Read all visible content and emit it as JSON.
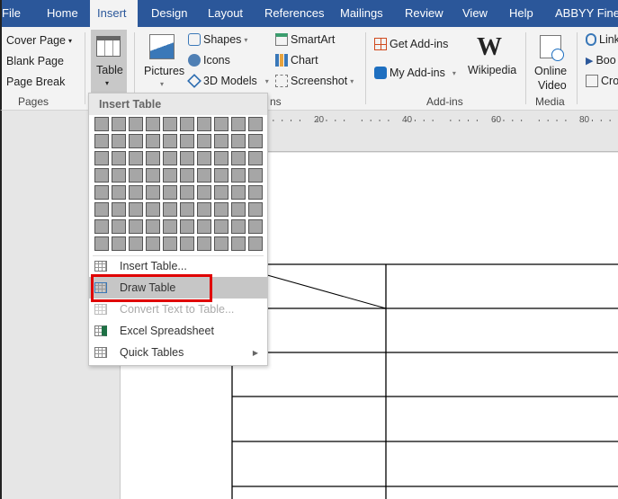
{
  "tabs": [
    {
      "label": "File"
    },
    {
      "label": "Home"
    },
    {
      "label": "Insert",
      "active": true
    },
    {
      "label": "Design"
    },
    {
      "label": "Layout"
    },
    {
      "label": "References"
    },
    {
      "label": "Mailings"
    },
    {
      "label": "Review"
    },
    {
      "label": "View"
    },
    {
      "label": "Help"
    },
    {
      "label": "ABBYY FineRe"
    }
  ],
  "ribbon": {
    "pages": {
      "cover_page": "Cover Page",
      "blank_page": "Blank Page",
      "page_break": "Page Break",
      "group": "Pages"
    },
    "table": {
      "label": "Table"
    },
    "illustrations": {
      "pictures": "Pictures",
      "shapes": "Shapes",
      "icons": "Icons",
      "models": "3D Models",
      "smartart": "SmartArt",
      "chart": "Chart",
      "screenshot": "Screenshot",
      "group_partial": "ns"
    },
    "addins": {
      "get": "Get Add-ins",
      "my": "My Add-ins",
      "wikipedia": "Wikipedia",
      "group": "Add-ins"
    },
    "media": {
      "online_video_1": "Online",
      "online_video_2": "Video",
      "group": "Media"
    },
    "links": {
      "link": "Link",
      "bookmark": "Boo",
      "cross": "Cro"
    }
  },
  "ruler": {
    "labels": [
      "20",
      "40",
      "60",
      "80"
    ]
  },
  "menu": {
    "header": "Insert Table",
    "grid": {
      "columns": 10,
      "rows": 8
    },
    "items": [
      {
        "label": "Insert Table..."
      },
      {
        "label": "Draw Table",
        "highlighted": true
      },
      {
        "label": "Convert Text to Table...",
        "disabled": true
      },
      {
        "label": "Excel Spreadsheet"
      },
      {
        "label": "Quick Tables",
        "submenu": true
      }
    ]
  },
  "colors": {
    "tabbar": "#2b579a",
    "highlight_box": "#e00000"
  }
}
